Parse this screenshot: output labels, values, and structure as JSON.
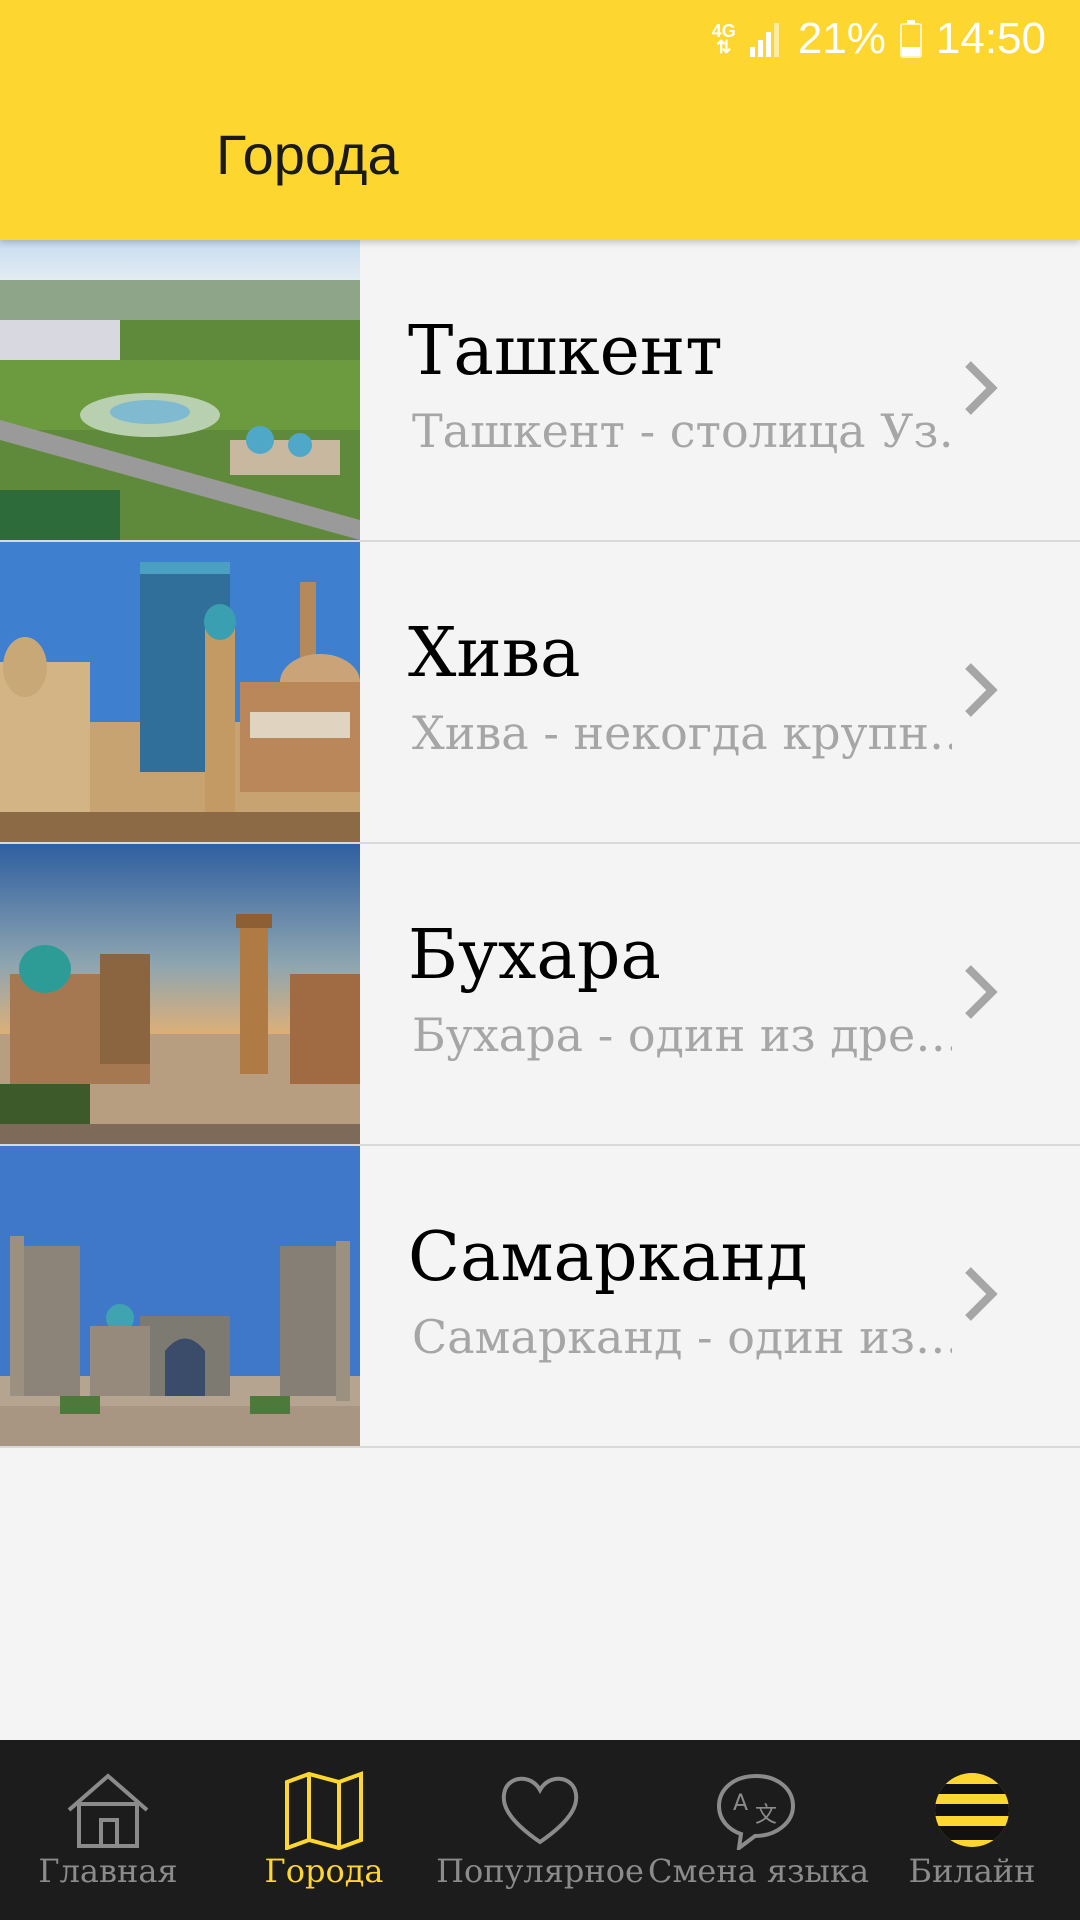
{
  "status_bar": {
    "network": "4G",
    "battery": "21%",
    "time": "14:50"
  },
  "header": {
    "title": "Города"
  },
  "cities": [
    {
      "name": "Ташкент",
      "description": "Ташкент - столица Уз…"
    },
    {
      "name": "Хива",
      "description": "Хива - некогда крупн…"
    },
    {
      "name": "Бухара",
      "description": "Бухара - один из дре…"
    },
    {
      "name": "Самарканд",
      "description": "Самарканд - один из…"
    }
  ],
  "bottom_nav": [
    {
      "label": "Главная",
      "icon": "home-icon"
    },
    {
      "label": "Города",
      "icon": "map-icon",
      "active": true
    },
    {
      "label": "Популярное",
      "icon": "heart-icon"
    },
    {
      "label": "Смена языка",
      "icon": "translate-icon"
    },
    {
      "label": "Билайн",
      "icon": "beeline-logo-icon"
    }
  ],
  "colors": {
    "accent": "#fed630",
    "nav_bg": "#1c1c1c",
    "inactive": "#8b8b8b"
  }
}
